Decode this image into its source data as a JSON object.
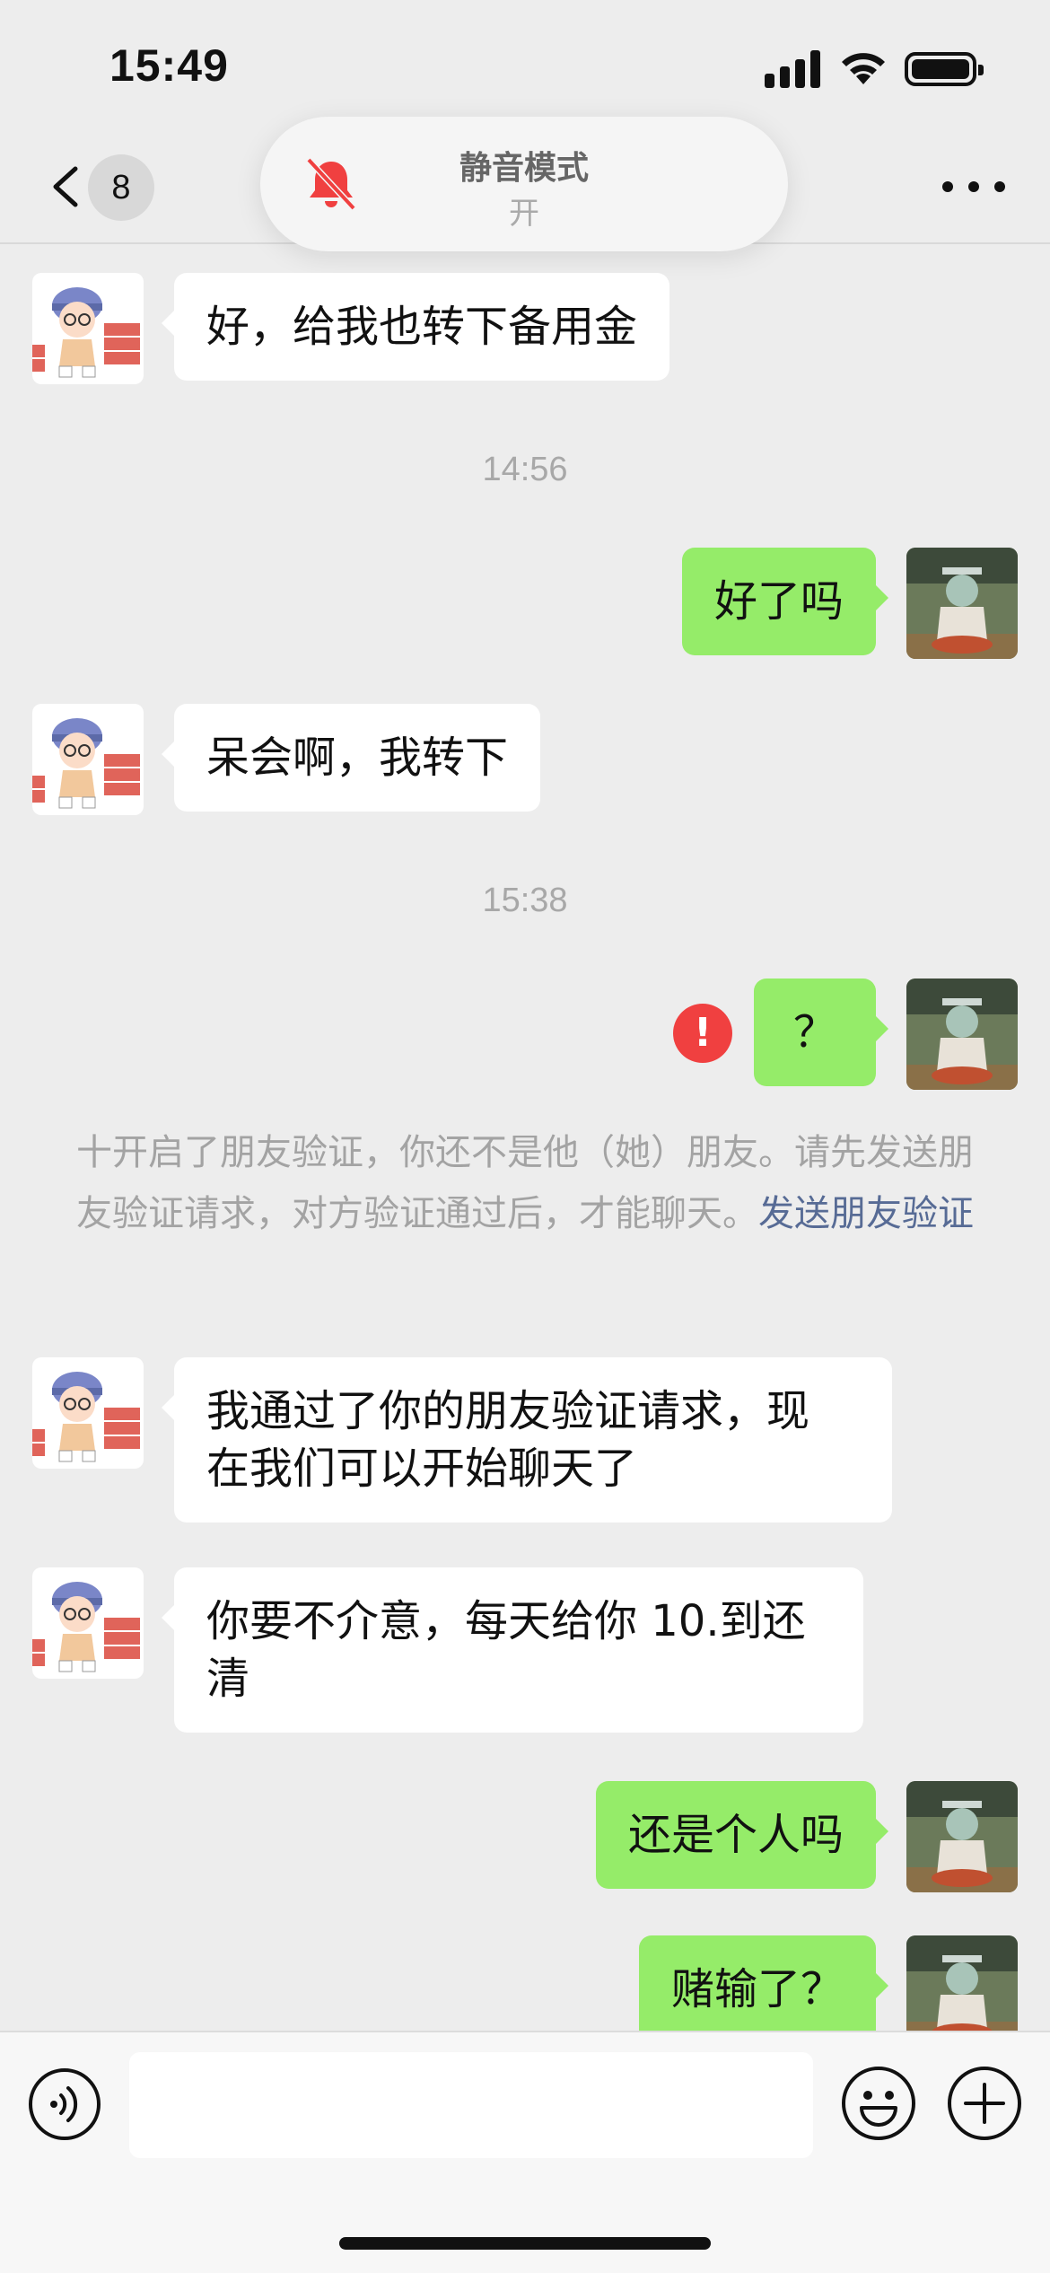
{
  "status_bar": {
    "time": "15:49"
  },
  "nav": {
    "back_badge": "8"
  },
  "toast": {
    "title": "静音模式",
    "state": "开",
    "icon": "bell-slash-icon",
    "icon_color": "#f04040"
  },
  "messages": [
    {
      "side": "in",
      "text": "好，给我也转下备用金"
    },
    {
      "type": "timestamp",
      "text": "14:56"
    },
    {
      "side": "out",
      "text": "好了吗"
    },
    {
      "side": "in",
      "text": "呆会啊，我转下"
    },
    {
      "type": "timestamp",
      "text": "15:38"
    },
    {
      "side": "out",
      "text": "？",
      "status": "failed"
    },
    {
      "type": "system",
      "text": "十开启了朋友验证，你还不是他（她）朋友。请先发送朋友验证请求，对方验证通过后，才能聊天。",
      "link": "发送朋友验证"
    },
    {
      "side": "in",
      "text_lines": [
        "我通过了你的朋友验证请求，现",
        "在我们可以开始聊天了"
      ]
    },
    {
      "side": "in",
      "text_lines": [
        "你要不介意，每天给你 10.到还",
        "清"
      ]
    },
    {
      "side": "out",
      "text": "还是个人吗"
    },
    {
      "side": "out",
      "text": "赌输了？"
    }
  ],
  "error_glyph": "!",
  "input_bar": {
    "text_value": "",
    "icons": [
      "voice-icon",
      "emoji-icon",
      "plus-icon"
    ]
  },
  "colors": {
    "outgoing_bubble": "#95ec69",
    "incoming_bubble": "#ffffff",
    "background": "#ededed",
    "link": "#576b95",
    "error": "#f04040"
  }
}
